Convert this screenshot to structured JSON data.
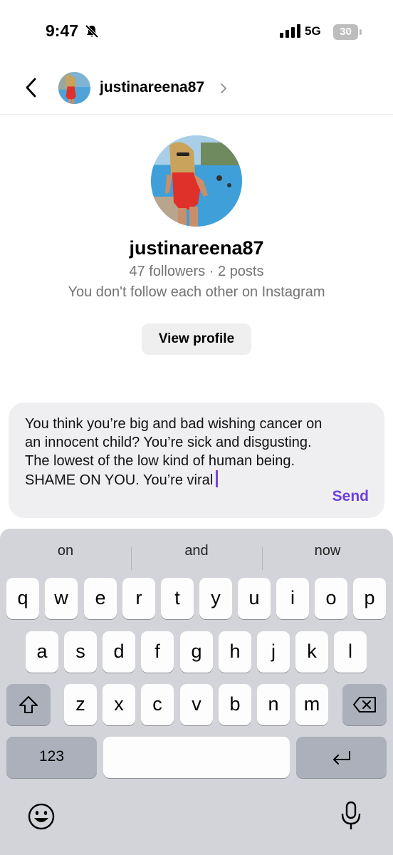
{
  "status_bar": {
    "time": "9:47",
    "network": "5G",
    "battery": "30"
  },
  "header": {
    "username": "justinareena87"
  },
  "profile": {
    "username": "justinareena87",
    "stats": "47 followers · 2 posts",
    "follow_note": "You don't follow each other on Instagram",
    "view_profile_label": "View profile"
  },
  "composer": {
    "text": "You think you’re big and bad wishing cancer on an innocent child? You’re sick and disgusting. The lowest of the low kind of human being. SHAME ON YOU. You’re viral",
    "send_label": "Send",
    "accent": "#6c3fe0"
  },
  "keyboard": {
    "suggestions": [
      "on",
      "and",
      "now"
    ],
    "row1": [
      "q",
      "w",
      "e",
      "r",
      "t",
      "y",
      "u",
      "i",
      "o",
      "p"
    ],
    "row2": [
      "a",
      "s",
      "d",
      "f",
      "g",
      "h",
      "j",
      "k",
      "l"
    ],
    "row3": [
      "z",
      "x",
      "c",
      "v",
      "b",
      "n",
      "m"
    ],
    "numbers_label": "123",
    "icons": [
      "shift-icon",
      "backspace-icon",
      "return-icon",
      "emoji-icon",
      "microphone-icon"
    ]
  }
}
